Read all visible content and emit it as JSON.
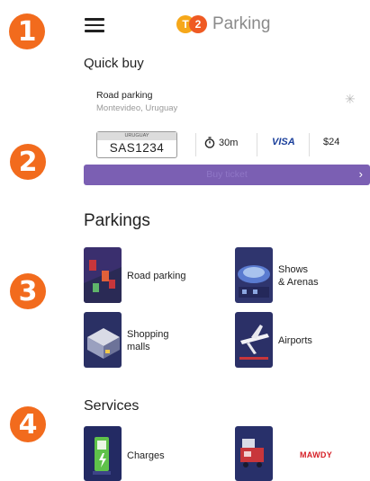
{
  "steps": [
    "1",
    "2",
    "3",
    "4"
  ],
  "header": {
    "logo_letter": "T",
    "logo_number": "2",
    "title": "Parking"
  },
  "quick_buy": {
    "title": "Quick buy",
    "place": "Road parking",
    "city": "Montevideo, Uruguay",
    "plate_country": "URUGUAY",
    "plate": "SAS1234",
    "duration": "30m",
    "payment": "VISA",
    "price": "$24",
    "button": "Buy ticket"
  },
  "parkings": {
    "title": "Parkings",
    "items": [
      "Road parking",
      "Shows\n& Arenas",
      "Shopping\nmalls",
      "Airports"
    ]
  },
  "services": {
    "title": "Services",
    "items": [
      "Charges",
      "MAWDY"
    ]
  },
  "colors": {
    "badge": "#f26b1d",
    "buy_button": "#7b5fb3",
    "tile_bg": "#2e2f6b",
    "mawdy": "#d62027"
  }
}
